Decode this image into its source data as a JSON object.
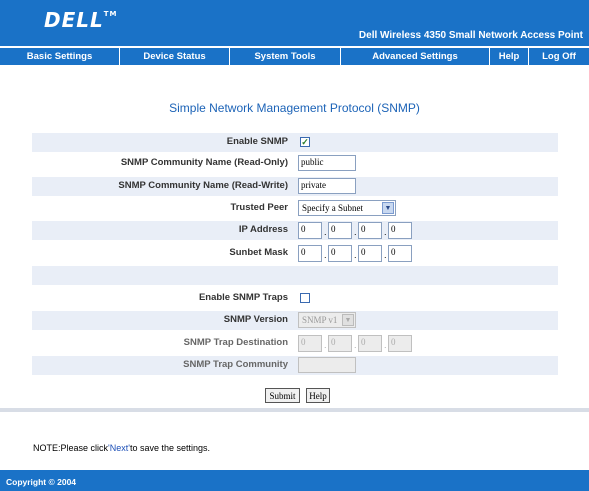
{
  "brand": {
    "logo": "DELL",
    "tm": "TM",
    "product": "Dell Wireless 4350 Small Network Access Point"
  },
  "nav": {
    "basic_settings": "Basic Settings",
    "device_status": "Device Status",
    "system_tools": "System Tools",
    "advanced_settings": "Advanced Settings",
    "help": "Help",
    "log_off": "Log Off"
  },
  "page": {
    "title": "Simple Network Management Protocol (SNMP)"
  },
  "form": {
    "enable_snmp": {
      "label": "Enable SNMP",
      "checked": true
    },
    "read_only": {
      "label": "SNMP Community Name (Read-Only)",
      "value": "public"
    },
    "read_write": {
      "label": "SNMP Community Name (Read-Write)",
      "value": "private"
    },
    "trusted_peer": {
      "label": "Trusted Peer",
      "value": "Specify a Subnet"
    },
    "ip_address": {
      "label": "IP Address",
      "o1": "0",
      "o2": "0",
      "o3": "0",
      "o4": "0"
    },
    "subnet_mask": {
      "label": "Sunbet Mask",
      "o1": "0",
      "o2": "0",
      "o3": "0",
      "o4": "0"
    },
    "enable_traps": {
      "label": "Enable SNMP Traps",
      "checked": false
    },
    "snmp_version": {
      "label": "SNMP Version",
      "value": "SNMP v1"
    },
    "trap_destination": {
      "label": "SNMP Trap Destination",
      "o1": "0",
      "o2": "0",
      "o3": "0",
      "o4": "0"
    },
    "trap_community": {
      "label": "SNMP Trap Community",
      "value": ""
    },
    "dot": "."
  },
  "buttons": {
    "submit": "Submit",
    "help": "Help"
  },
  "note": {
    "prefix": "NOTE:Please click",
    "link": "'Next'",
    "suffix": "to save the settings."
  },
  "footer": {
    "copyright": "Copyright © 2004"
  },
  "colors": {
    "header_blue": "#1a72c7",
    "title_blue": "#1c63b7",
    "row_shade": "#e9eef7"
  }
}
